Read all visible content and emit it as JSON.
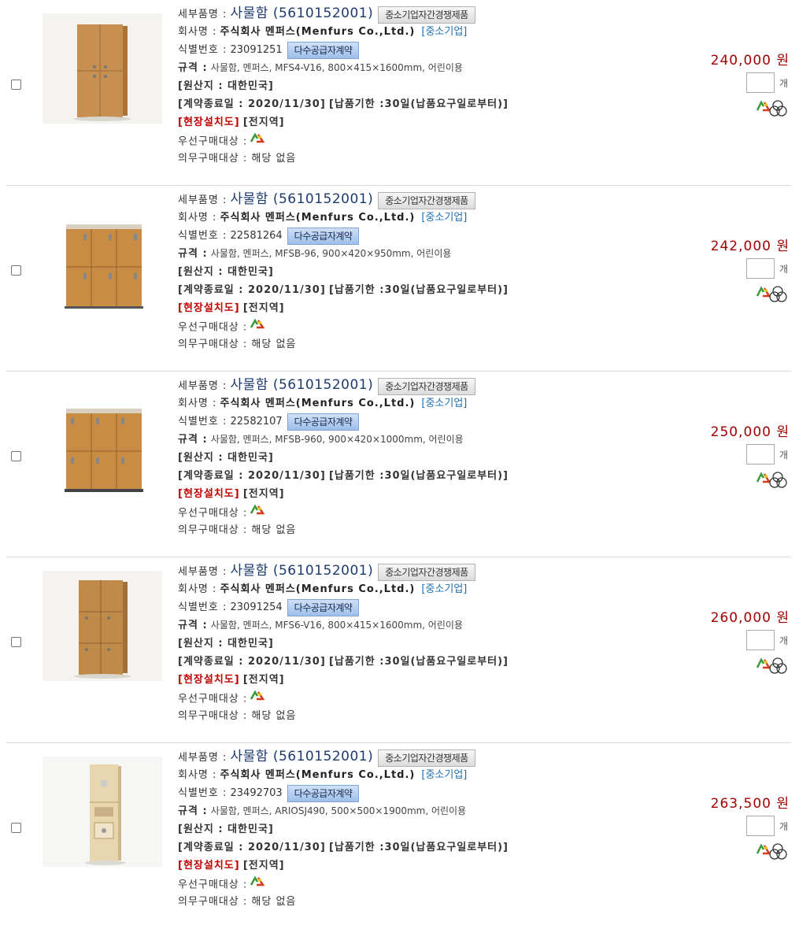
{
  "labels": {
    "item_name": "세부품명 :",
    "company": "회사명 :",
    "id": "식별번호 :",
    "spec": "규격 :",
    "origin": "[원산지 : 대한민국]",
    "contract_end": "[계약종료일 : 2020/11/30]",
    "delivery": "[납품기한 :30일(납품요구일로부터)]",
    "install": "[현장설치도]",
    "region": "[전지역]",
    "priority": "우선구매대상 :",
    "mandatory": "의무구매대상 : 해당 없음",
    "competitive_badge": "중소기업자간경쟁제품",
    "contract_badge": "다수공급자계약",
    "company_size": "[중소기업]",
    "qty_unit": "개",
    "recycle_icon": "recycle-icon",
    "cert_icon": "certification-icon"
  },
  "colors": {
    "price": "#a30000",
    "install": "#c00000",
    "product_name": "#1d3a6e",
    "company_size": "#1f6fb3"
  },
  "products": [
    {
      "name": "사물함 (5610152001)",
      "company": "주식회사 멘퍼스(Menfurs Co.,Ltd.)",
      "id": "23091251",
      "spec": "사물함, 멘퍼스, MFS4-V16, 800×415×1600mm, 어린이용",
      "price": "240,000 원",
      "image": "tall-2-door-locker"
    },
    {
      "name": "사물함 (5610152001)",
      "company": "주식회사 멘퍼스(Menfurs Co.,Ltd.)",
      "id": "22581264",
      "spec": "사물함, 멘퍼스, MFSB-96, 900×420×950mm, 어린이용",
      "price": "242,000 원",
      "image": "6-cell-low-locker"
    },
    {
      "name": "사물함 (5610152001)",
      "company": "주식회사 멘퍼스(Menfurs Co.,Ltd.)",
      "id": "22582107",
      "spec": "사물함, 멘퍼스, MFSB-960, 900×420×1000mm, 어린이용",
      "price": "250,000 원",
      "image": "6-cell-low-locker"
    },
    {
      "name": "사물함 (5610152001)",
      "company": "주식회사 멘퍼스(Menfurs Co.,Ltd.)",
      "id": "23091254",
      "spec": "사물함, 멘퍼스, MFS6-V16, 800×415×1600mm, 어린이용",
      "price": "260,000 원",
      "image": "tall-6-cell-locker"
    },
    {
      "name": "사물함 (5610152001)",
      "company": "주식회사 멘퍼스(Menfurs Co.,Ltd.)",
      "id": "23492703",
      "spec": "사물함, 멘퍼스, ARIOSJ490, 500×500×1900mm, 어린이용",
      "price": "263,500 원",
      "image": "narrow-light-locker"
    }
  ]
}
